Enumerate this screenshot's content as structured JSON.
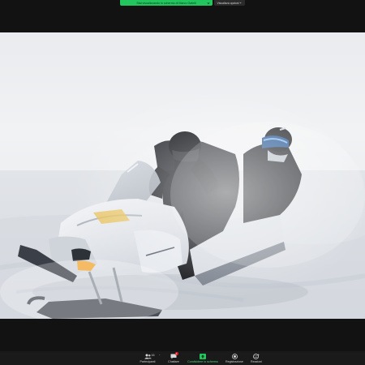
{
  "top_bar": {
    "share_banner": "Stai visualizzando lo schermo di Marco Gatelli",
    "view_options": "Visualizza opzioni"
  },
  "screen": {
    "content": "snowmobile-photo"
  },
  "toolbar": {
    "participants": {
      "label": "Partecipanti",
      "count": "16",
      "icon": "people-icon"
    },
    "chat": {
      "label": "Chattare",
      "badge": "1",
      "icon": "chat-icon"
    },
    "share_screen": {
      "label": "Condividere lo schermo",
      "icon": "share-screen-icon"
    },
    "record": {
      "label": "Registrazione",
      "icon": "record-icon"
    },
    "reactions": {
      "label": "Reazioni",
      "icon": "reaction-icon"
    }
  },
  "colors": {
    "share_banner": "#22c55e",
    "background": "#121212",
    "toolbar": "#1a1a1a",
    "share_screen_accent": "#22c55e",
    "chat_badge": "#e11d2e"
  }
}
